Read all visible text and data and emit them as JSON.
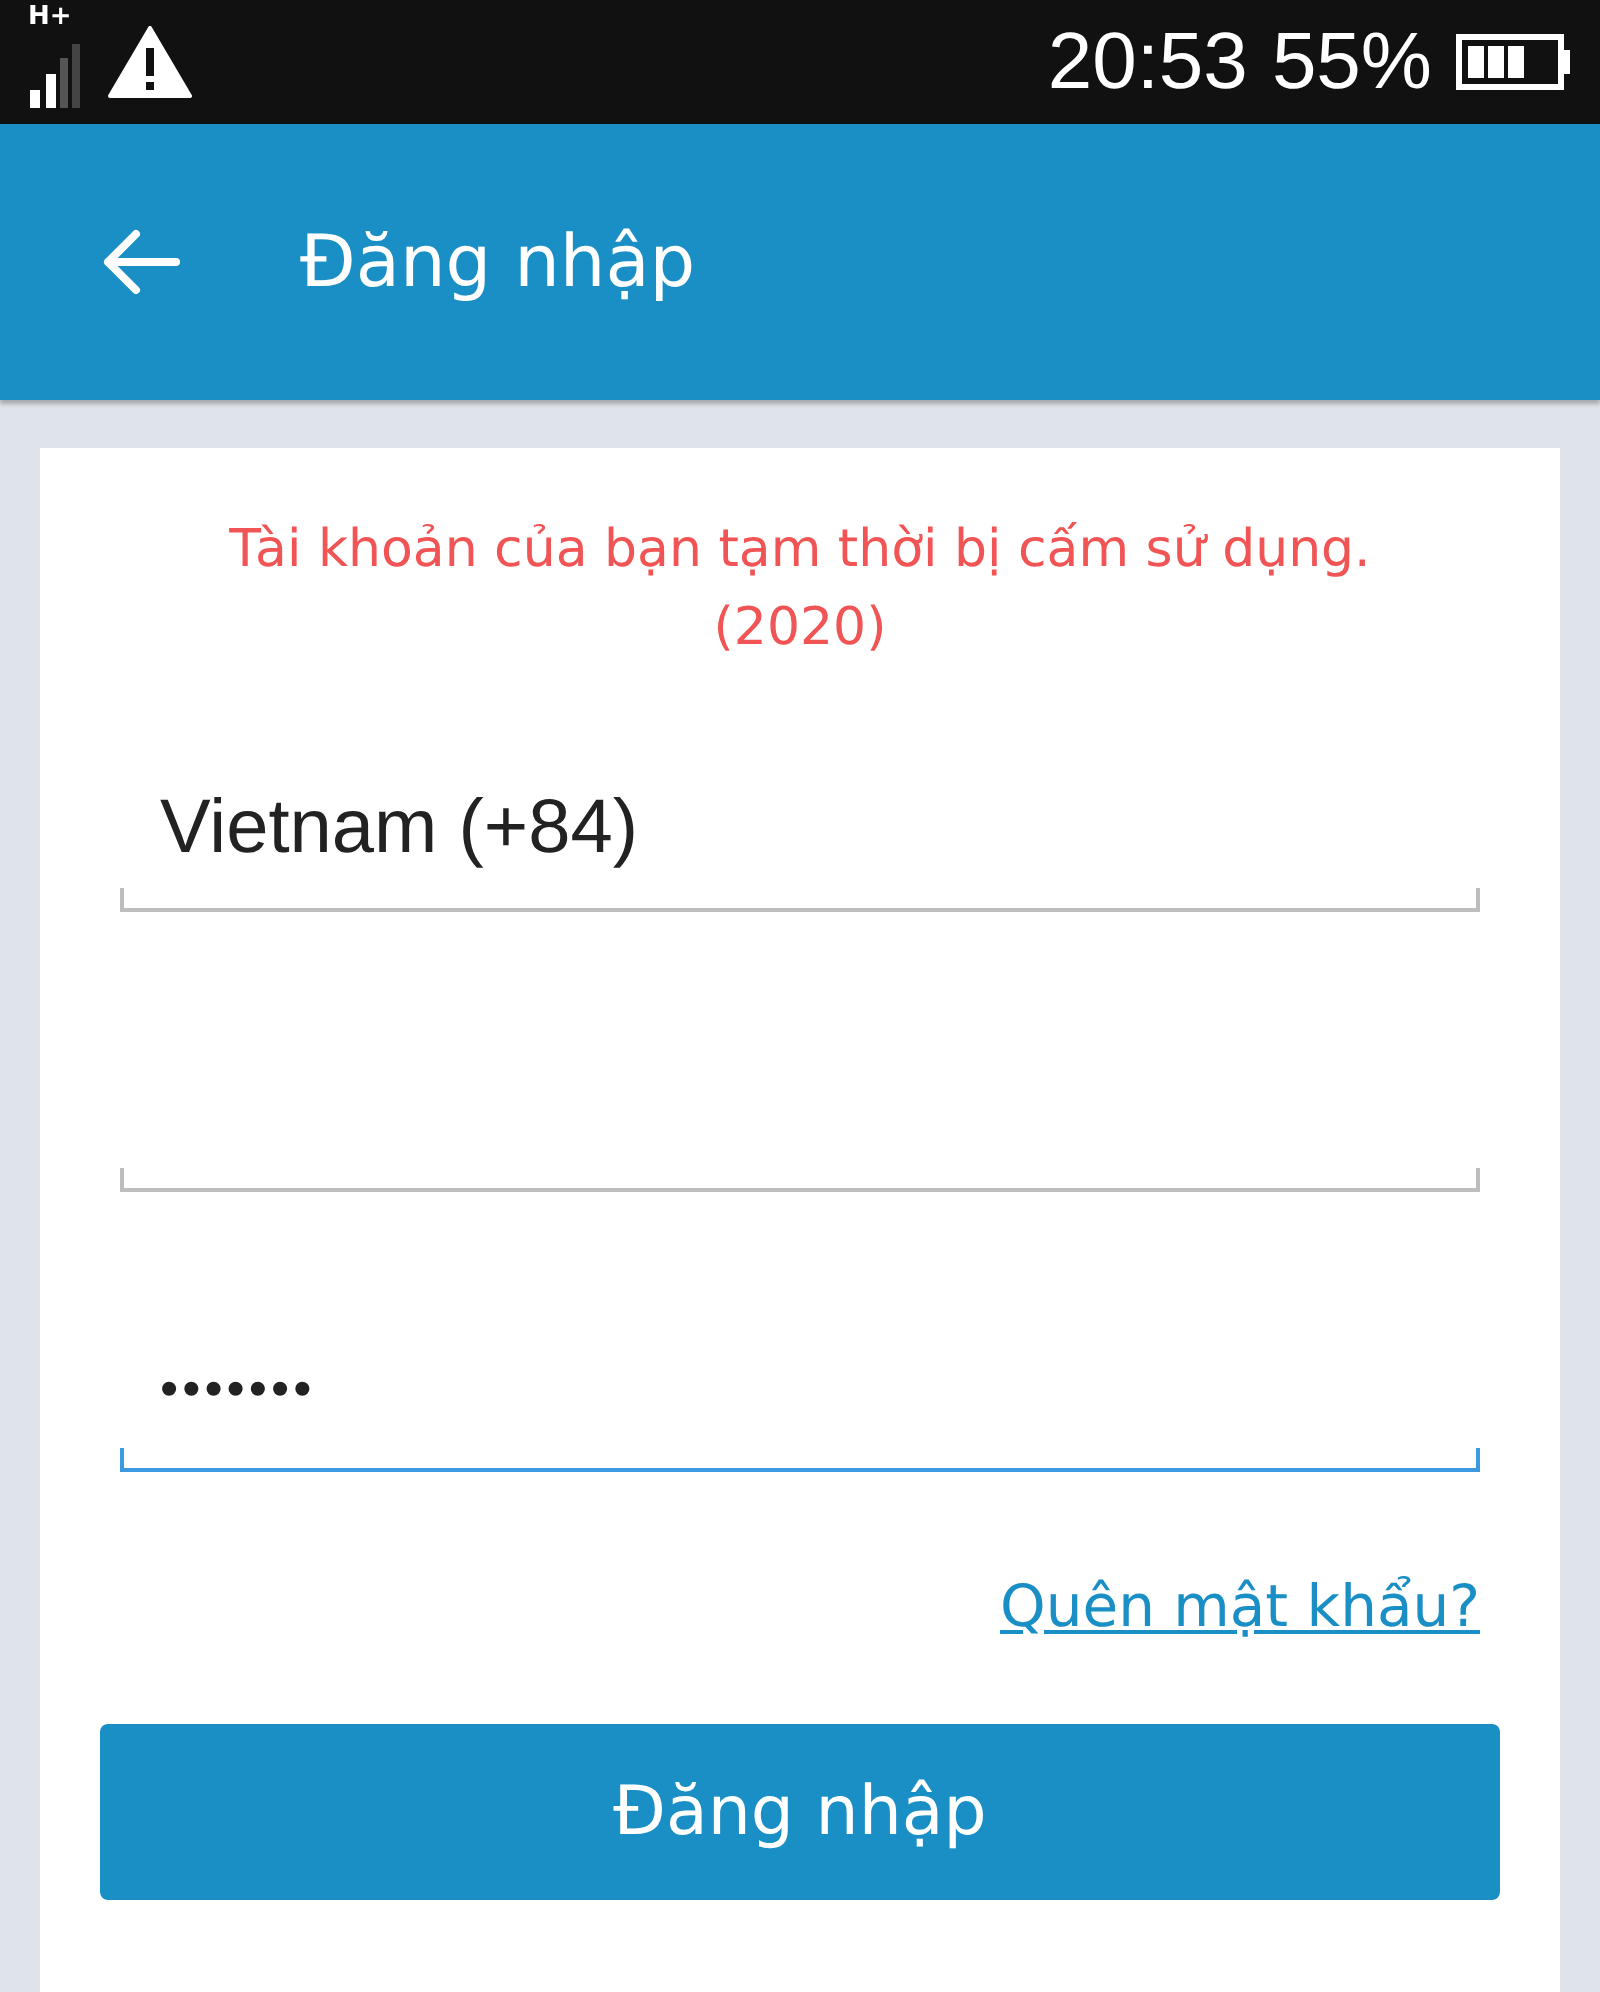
{
  "status_bar": {
    "network": "H+",
    "time": "20:53",
    "battery": "55%"
  },
  "app_bar": {
    "title": "Đăng nhập"
  },
  "error_message": "Tài khoản của bạn tạm thời bị cấm sử dụng. (2020)",
  "fields": [
    {
      "kind": "select",
      "value": "Vietnam (+84)",
      "focused": false
    },
    {
      "kind": "phone",
      "focused": false
    },
    {
      "kind": "password",
      "value": "•••••••",
      "focused": true
    }
  ],
  "forgot_link": "Quên mật khẩu?",
  "login_button": "Đăng nhập"
}
